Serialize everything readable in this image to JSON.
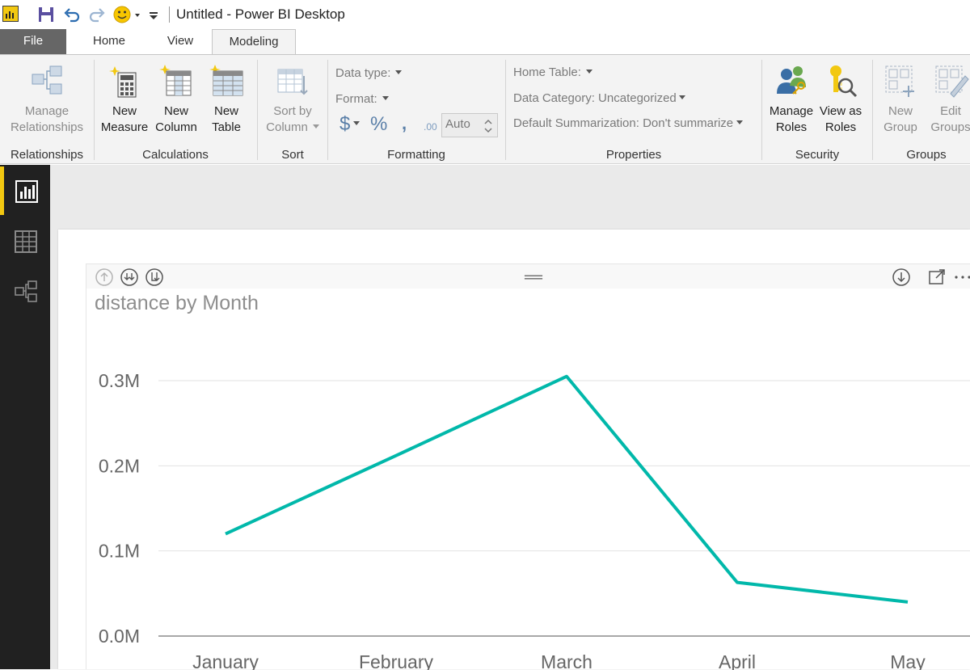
{
  "window": {
    "title": "Untitled - Power BI Desktop"
  },
  "tabs": {
    "file": "File",
    "home": "Home",
    "view": "View",
    "modeling": "Modeling"
  },
  "ribbon": {
    "relationships": {
      "manage_1": "Manage",
      "manage_2": "Relationships",
      "label": "Relationships"
    },
    "calculations": {
      "new_measure_1": "New",
      "new_measure_2": "Measure",
      "new_column_1": "New",
      "new_column_2": "Column",
      "new_table_1": "New",
      "new_table_2": "Table",
      "label": "Calculations"
    },
    "sort": {
      "sort_by_1": "Sort by",
      "sort_by_2": "Column",
      "label": "Sort"
    },
    "formatting": {
      "data_type": "Data type:",
      "format": "Format:",
      "dollar": "$",
      "percent": "%",
      "comma": ",",
      "decimals": ".00",
      "auto_value": "Auto",
      "label": "Formatting"
    },
    "properties": {
      "home_table": "Home Table:",
      "data_category": "Data Category: Uncategorized",
      "default_summarization": "Default Summarization: Don't summarize",
      "label": "Properties"
    },
    "security": {
      "manage_roles_1": "Manage",
      "manage_roles_2": "Roles",
      "view_as_1": "View as",
      "view_as_2": "Roles",
      "label": "Security"
    },
    "groups": {
      "new_group_1": "New",
      "new_group_2": "Group",
      "edit_groups_1": "Edit",
      "edit_groups_2": "Groups",
      "label": "Groups"
    }
  },
  "colors": {
    "accent": "#f2c811",
    "series": "#01b8aa",
    "nav_bg": "#212121",
    "file_tab": "#666666"
  },
  "chart_data": {
    "type": "line",
    "title": "distance by Month",
    "categories": [
      "January",
      "February",
      "March",
      "April",
      "May"
    ],
    "series": [
      {
        "values": [
          120000,
          212000,
          305000,
          63000,
          40000
        ]
      }
    ],
    "ylim": [
      0,
      300000
    ],
    "yticks": [
      0,
      100000,
      200000,
      300000
    ],
    "ytick_labels": [
      "0.0M",
      "0.1M",
      "0.2M",
      "0.3M"
    ],
    "grid": true,
    "legend": "none"
  }
}
